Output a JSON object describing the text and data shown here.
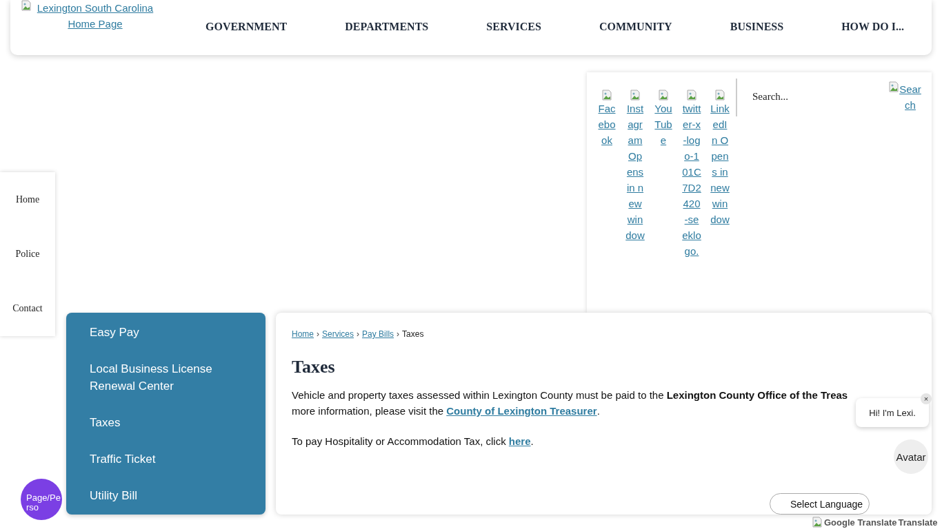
{
  "header": {
    "logo_alt": "Lexington South Carolina Home Page",
    "nav": [
      {
        "label": "GOVERNMENT"
      },
      {
        "label": "DEPARTMENTS"
      },
      {
        "label": "SERVICES"
      },
      {
        "label": "COMMUNITY"
      },
      {
        "label": "BUSINESS"
      },
      {
        "label": "HOW DO I..."
      }
    ]
  },
  "social_links": [
    {
      "alt": "Facebook"
    },
    {
      "alt": "Instagram Opens in new window"
    },
    {
      "alt": "YouTube"
    },
    {
      "alt": "twitter-x-logo-101C7D2420-seeklogo."
    },
    {
      "alt": "LinkedIn Opens in new window"
    }
  ],
  "search": {
    "placeholder": "Search...",
    "button_alt": "Search"
  },
  "quick_links": [
    {
      "label": "Home"
    },
    {
      "label": "Police"
    },
    {
      "label": "Contact"
    }
  ],
  "side_nav": [
    {
      "label": "Easy Pay"
    },
    {
      "label": "Local Business License Renewal Center"
    },
    {
      "label": "Taxes"
    },
    {
      "label": "Traffic Ticket"
    },
    {
      "label": "Utility Bill"
    }
  ],
  "breadcrumb": [
    {
      "label": "Home",
      "link": true
    },
    {
      "separator": "›",
      "label": "Services",
      "link": true
    },
    {
      "separator": "›",
      "label": "Pay Bills",
      "link": true
    },
    {
      "separator": "›",
      "label": "Taxes",
      "link": false
    }
  ],
  "title": "Taxes",
  "paragraph1": {
    "line1": "Vehicle and property taxes assessed within Lexington County must be paid to the **Lexington County Office of the Treas**",
    "line2": "more information, please visit the ",
    "link": "County of Lexington Treasurer",
    "after": "."
  },
  "paragraph2": {
    "text": "To pay Hospitality or Accommodation Tax, click ",
    "link": "here",
    "after": "."
  },
  "chat": {
    "greeting": "Hi! I'm Lexi.",
    "close": "×",
    "avatar_alt": "Avatar"
  },
  "language": {
    "label": "Select Language",
    "logo_alt": "Google Translate",
    "text": "Translate"
  },
  "page_widget": {
    "alt": "Page/Perso"
  }
}
